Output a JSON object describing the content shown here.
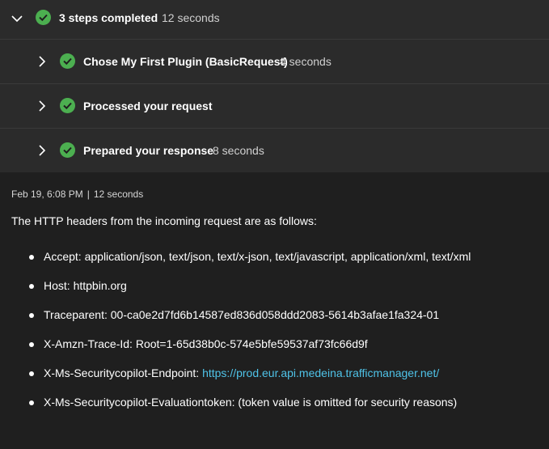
{
  "steps": {
    "header": {
      "title": "3 steps completed",
      "time": "12 seconds",
      "icon": "chevron-down-icon"
    },
    "items": [
      {
        "title": "Chose My First Plugin (BasicRequest)",
        "time": "4 seconds"
      },
      {
        "title": "Processed your request",
        "time": ""
      },
      {
        "title": "Prepared your response",
        "time": "8 seconds"
      }
    ],
    "check_color": "#4caf50"
  },
  "response": {
    "date": "Feb 19, 6:08 PM",
    "separator": "|",
    "duration": "12 seconds",
    "intro": "The HTTP headers from the incoming request are as follows:",
    "headers": [
      {
        "text": "Accept: application/json, text/json, text/x-json, text/javascript, application/xml, text/xml"
      },
      {
        "text": "Host: httpbin.org"
      },
      {
        "text": "Traceparent: 00-ca0e2d7fd6b14587ed836d058ddd2083-5614b3afae1fa324-01"
      },
      {
        "text": "X-Amzn-Trace-Id: Root=1-65d38b0c-574e5bfe59537af73fc66d9f"
      },
      {
        "text": "X-Ms-Securitycopilot-Endpoint: ",
        "link": "https://prod.eur.api.medeina.trafficmanager.net/"
      },
      {
        "text": "X-Ms-Securitycopilot-Evaluationtoken: (token value is omitted for security reasons)"
      }
    ],
    "link_color": "#4fc3e8"
  }
}
